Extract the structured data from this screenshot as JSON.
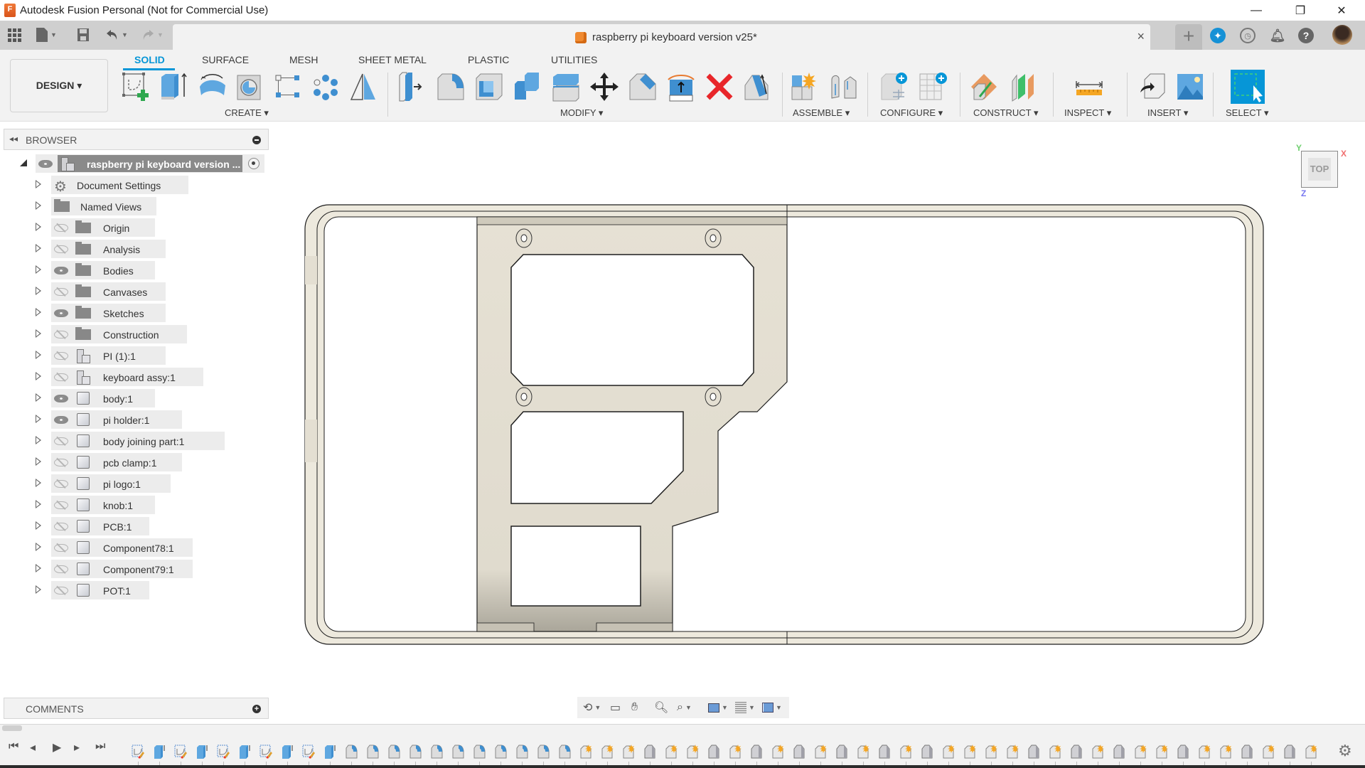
{
  "window": {
    "title": "Autodesk Fusion Personal (Not for Commercial Use)",
    "logo_letter": "F",
    "controls": {
      "minimize": "—",
      "maximize": "❐",
      "close": "✕"
    }
  },
  "quick_access": {
    "grid_icon": "apps-grid-icon",
    "file_icon": "file-icon",
    "save_icon": "save-icon",
    "undo_icon": "undo-icon",
    "redo_icon": "redo-icon"
  },
  "document_tab": {
    "title": "raspberry pi keyboard version v25*",
    "close": "×",
    "new_tab": "+"
  },
  "header_icons": [
    "extensions-icon",
    "job-status-icon",
    "notifications-icon",
    "help-icon",
    "user-avatar"
  ],
  "workspace": {
    "label": "DESIGN ▾"
  },
  "ribbon": {
    "tabs": [
      {
        "label": "SOLID",
        "active": true
      },
      {
        "label": "SURFACE",
        "active": false
      },
      {
        "label": "MESH",
        "active": false
      },
      {
        "label": "SHEET METAL",
        "active": false
      },
      {
        "label": "PLASTIC",
        "active": false
      },
      {
        "label": "UTILITIES",
        "active": false
      }
    ],
    "groups": [
      {
        "label": "CREATE ▾",
        "tools": [
          "create-sketch",
          "extrude",
          "revolve",
          "hole",
          "rectangular-pattern",
          "circular-pattern",
          "mirror"
        ]
      },
      {
        "label": "MODIFY ▾",
        "tools": [
          "press-pull",
          "fillet",
          "shell",
          "combine",
          "offset-face",
          "move-copy",
          "chamfer",
          "replace-face",
          "delete",
          "draft"
        ]
      },
      {
        "label": "ASSEMBLE ▾",
        "tools": [
          "new-component",
          "joint"
        ]
      },
      {
        "label": "CONFIGURE ▾",
        "tools": [
          "create-configuration",
          "configuration-table"
        ]
      },
      {
        "label": "CONSTRUCT ▾",
        "tools": [
          "offset-plane",
          "midplane"
        ]
      },
      {
        "label": "INSPECT ▾",
        "tools": [
          "measure"
        ]
      },
      {
        "label": "INSERT ▾",
        "tools": [
          "insert-derive",
          "insert-canvas"
        ]
      },
      {
        "label": "SELECT ▾",
        "tools": [
          "window-select"
        ]
      }
    ]
  },
  "browser": {
    "title": "BROWSER",
    "root": {
      "label": "raspberry pi keyboard version ...",
      "visible": true
    },
    "items": [
      {
        "label": "Document Settings",
        "icon": "gear",
        "eye": null
      },
      {
        "label": "Named Views",
        "icon": "folder",
        "eye": null
      },
      {
        "label": "Origin",
        "icon": "folder",
        "eye": "off"
      },
      {
        "label": "Analysis",
        "icon": "folder",
        "eye": "off"
      },
      {
        "label": "Bodies",
        "icon": "folder",
        "eye": "on"
      },
      {
        "label": "Canvases",
        "icon": "folder",
        "eye": "off"
      },
      {
        "label": "Sketches",
        "icon": "folder",
        "eye": "on"
      },
      {
        "label": "Construction",
        "icon": "folder",
        "eye": "off"
      },
      {
        "label": "PI (1):1",
        "icon": "assembly",
        "eye": "off"
      },
      {
        "label": "keyboard assy:1",
        "icon": "assembly",
        "eye": "off"
      },
      {
        "label": "body:1",
        "icon": "component",
        "eye": "on"
      },
      {
        "label": "pi holder:1",
        "icon": "component",
        "eye": "on"
      },
      {
        "label": "body joining part:1",
        "icon": "component",
        "eye": "off"
      },
      {
        "label": "pcb clamp:1",
        "icon": "component",
        "eye": "off"
      },
      {
        "label": "pi logo:1",
        "icon": "component",
        "eye": "off"
      },
      {
        "label": "knob:1",
        "icon": "component",
        "eye": "off"
      },
      {
        "label": "PCB:1",
        "icon": "component",
        "eye": "off"
      },
      {
        "label": "Component78:1",
        "icon": "component",
        "eye": "off"
      },
      {
        "label": "Component79:1",
        "icon": "component",
        "eye": "off"
      },
      {
        "label": "POT:1",
        "icon": "component",
        "eye": "off"
      }
    ]
  },
  "comments": {
    "title": "COMMENTS"
  },
  "viewcube": {
    "face": "TOP",
    "axes": {
      "x": "X",
      "y": "Y",
      "z": "Z"
    },
    "colors": {
      "x": "#f07070",
      "y": "#70d070",
      "z": "#7878f0"
    }
  },
  "navbar": {
    "tools": [
      "orbit-icon",
      "look-at-icon",
      "pan-icon",
      "zoom-icon",
      "fit-icon",
      "display-settings-icon",
      "grid-icon",
      "viewports-icon"
    ]
  },
  "timeline": {
    "controls": [
      "first",
      "previous",
      "play",
      "next",
      "last"
    ],
    "features": [
      "sketch",
      "extrude",
      "sketch",
      "extrude",
      "sketch",
      "extrude",
      "sketch",
      "extrude",
      "sketch",
      "extrude",
      "fillet",
      "fillet",
      "fillet",
      "fillet",
      "fillet",
      "fillet",
      "fillet",
      "fillet",
      "fillet",
      "fillet",
      "fillet",
      "component",
      "component",
      "component",
      "body",
      "component",
      "component",
      "body",
      "component",
      "body",
      "component",
      "body",
      "component",
      "body",
      "component",
      "body",
      "component",
      "body",
      "component",
      "component",
      "component",
      "component",
      "body",
      "component",
      "body",
      "component",
      "body",
      "component",
      "component",
      "body",
      "component",
      "component",
      "body",
      "component",
      "body",
      "component"
    ]
  },
  "colors": {
    "accent": "#0696d7",
    "model_fill": "#e4dfd2",
    "model_edge": "#1e1e1e",
    "delete_red": "#e8262a"
  }
}
